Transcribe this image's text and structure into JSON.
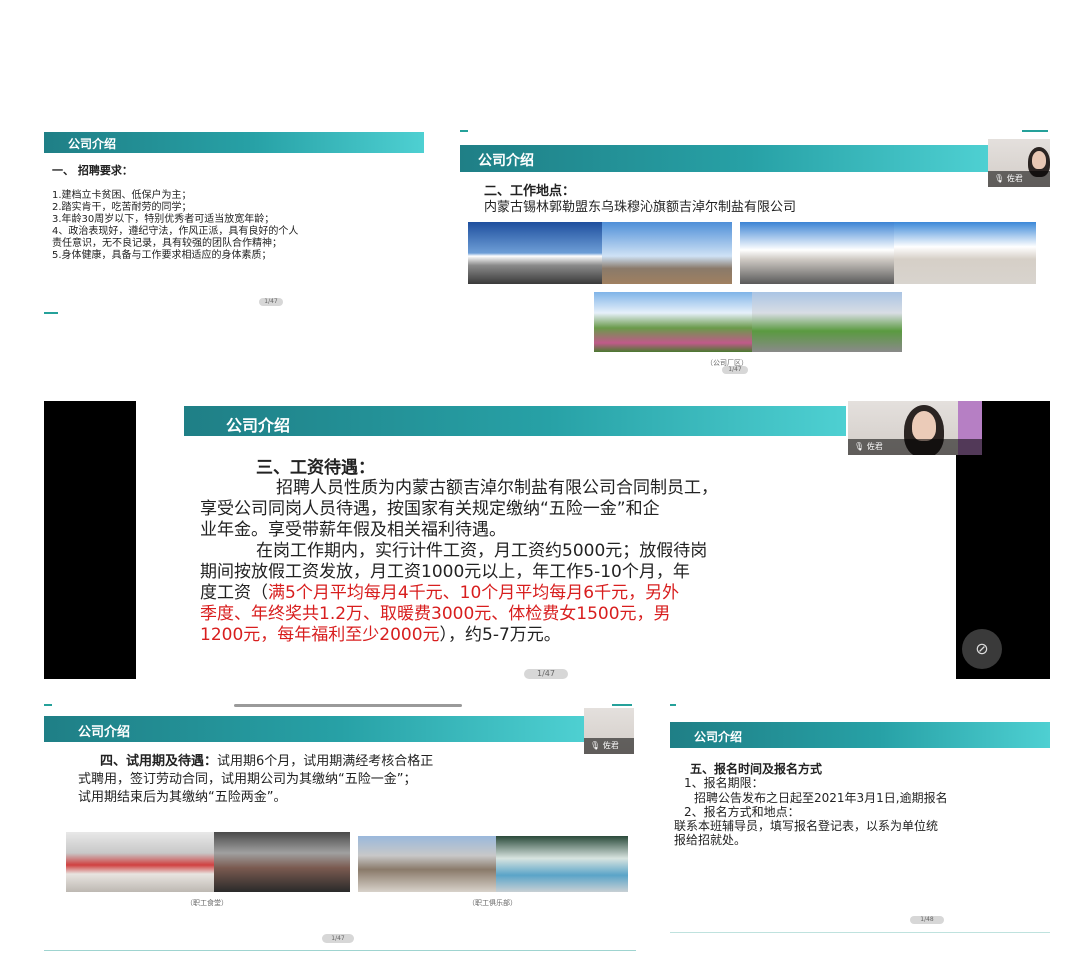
{
  "colors": {
    "header": "#27a1a6",
    "accent": "#25a19a",
    "red_text": "#d81e1e"
  },
  "slide1": {
    "header": "公司介绍",
    "section_title": "一、    招聘要求：",
    "items": [
      "1.建档立卡贫困、低保户为主；",
      "2.踏实肯干，吃苦耐劳的同学；",
      "3.年龄30周岁以下，特别优秀者可适当放宽年龄；",
      "4、政治表现好，遵纪守法，作风正派，具有良好的个人",
      "责任意识，无不良记录，具有较强的团队合作精神；",
      "5.身体健康，具备与工作要求相适应的身体素质；"
    ],
    "page": "1/47"
  },
  "slide2": {
    "header": "公司介绍",
    "section_title": "二、工作地点：",
    "location": "内蒙古锡林郭勒盟东乌珠穆沁旗额吉淖尔制盐有限公司",
    "caption": "（公司厂区）",
    "page": "1/47",
    "video_name": "佐君"
  },
  "slide3": {
    "header": "公司介绍",
    "section_title": "三、工资待遇：",
    "lines": [
      "招聘人员性质为内蒙古额吉淖尔制盐有限公司合同制员工，",
      "享受公司同岗人员待遇，按国家有关规定缴纳“五险一金”和企",
      "业年金。享受带薪年假及相关福利待遇。",
      "在岗工作期内，实行计件工资，月工资约5000元；放假待岗",
      "期间按放假工资发放，月工资1000元以上，年工作5-10个月，年"
    ],
    "line6_prefix": "度工资（",
    "line6_red": "满5个月平均每月4千元、10个月平均每月6千元，另外",
    "line7_red": "季度、年终奖共1.2万、取暖费3000元、体检费女1500元，男",
    "line8_red": "1200元，每年福利至少2000元",
    "line8_suffix": "），约5-7万元。",
    "page": "1/47",
    "video_name": "佐君"
  },
  "slide4": {
    "header": "公司介绍",
    "title": "四、试用期及待遇：",
    "lines": [
      "试用期6个月，试用期满经考核合格正",
      "式聘用，签订劳动合同，试用期公司为其缴纳“五险一金”；",
      "试用期结束后为其缴纳“五险两金”。"
    ],
    "caption_left": "（职工食堂）",
    "caption_right": "（职工俱乐部）",
    "page": "1/47",
    "video_name": "佐君"
  },
  "slide5": {
    "header": "公司介绍",
    "title": "五、报名时间及报名方式",
    "lines": [
      "1、报名期限：",
      "招聘公告发布之日起至2021年3月1日,逾期报名",
      "2、报名方式和地点：",
      "联系本班辅导员，填写报名登记表，以系为单位统",
      "报给招就处。"
    ],
    "page": "1/48"
  }
}
